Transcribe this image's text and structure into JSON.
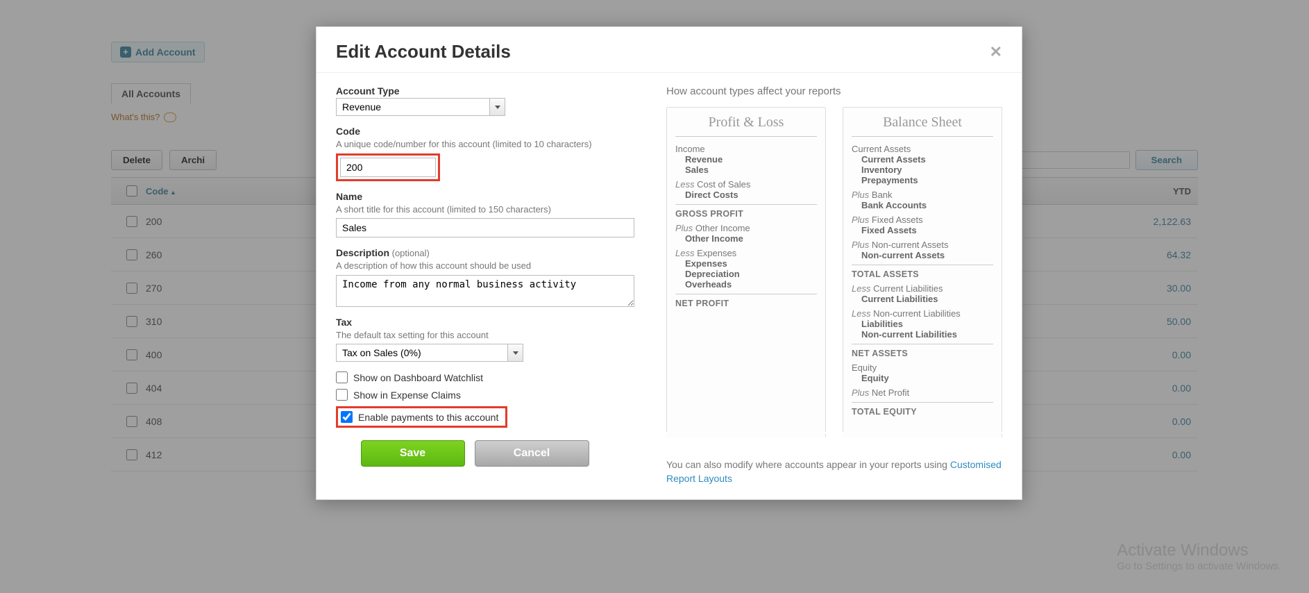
{
  "toolbar": {
    "add_account": "Add Account"
  },
  "tabs": {
    "all_accounts": "All Accounts"
  },
  "help_link": "What's this?",
  "actions": {
    "delete": "Delete",
    "archive": "Archi",
    "search": "Search"
  },
  "table": {
    "head_code": "Code",
    "head_ytd": "YTD",
    "rows": [
      {
        "code": "200",
        "ytd": "2,122.63"
      },
      {
        "code": "260",
        "ytd": "64.32"
      },
      {
        "code": "270",
        "ytd": "30.00"
      },
      {
        "code": "310",
        "ytd": "50.00"
      },
      {
        "code": "400",
        "ytd": "0.00"
      },
      {
        "code": "404",
        "ytd": "0.00"
      },
      {
        "code": "408",
        "ytd": "0.00"
      },
      {
        "code": "412",
        "ytd": "0.00"
      }
    ]
  },
  "modal": {
    "title": "Edit Account Details",
    "account_type_label": "Account Type",
    "account_type_value": "Revenue",
    "code_label": "Code",
    "code_help": "A unique code/number for this account (limited to 10 characters)",
    "code_value": "200",
    "name_label": "Name",
    "name_help": "A short title for this account (limited to 150 characters)",
    "name_value": "Sales",
    "desc_label": "Description",
    "desc_opt": " (optional)",
    "desc_help": "A description of how this account should be used",
    "desc_value": "Income from any normal business activity",
    "tax_label": "Tax",
    "tax_help": "The default tax setting for this account",
    "tax_value": "Tax on Sales (0%)",
    "chk_dashboard": "Show on Dashboard Watchlist",
    "chk_expense": "Show in Expense Claims",
    "chk_payments": "Enable payments to this account",
    "save": "Save",
    "cancel": "Cancel"
  },
  "info": {
    "head": "How account types affect your reports",
    "pl_title": "Profit & Loss",
    "bs_title": "Balance Sheet",
    "pl": {
      "income": "Income",
      "revenue": "Revenue",
      "sales": "Sales",
      "less_cos": "Less Cost of Sales",
      "direct_costs": "Direct Costs",
      "gross_profit": "GROSS PROFIT",
      "plus_other": "Plus Other Income",
      "other_income": "Other Income",
      "less_exp": "Less Expenses",
      "expenses": "Expenses",
      "depreciation": "Depreciation",
      "overheads": "Overheads",
      "net_profit": "NET PROFIT"
    },
    "bs": {
      "current_assets": "Current Assets",
      "ca_sub": "Current Assets",
      "inventory": "Inventory",
      "prepayments": "Prepayments",
      "plus_bank": "Plus Bank",
      "bank_accounts": "Bank Accounts",
      "plus_fixed": "Plus Fixed Assets",
      "fixed_assets": "Fixed Assets",
      "plus_nca": "Plus Non-current Assets",
      "nca": "Non-current Assets",
      "total_assets": "TOTAL ASSETS",
      "less_cl": "Less Current Liabilities",
      "cl": "Current Liabilities",
      "less_ncl": "Less Non-current Liabilities",
      "liabilities": "Liabilities",
      "ncl": "Non-current Liabilities",
      "net_assets": "NET ASSETS",
      "equity": "Equity",
      "equity_sub": "Equity",
      "plus_np": "Plus Net Profit",
      "total_equity": "TOTAL EQUITY"
    },
    "footer1": "You can also modify where accounts appear in your reports using ",
    "footer_link": "Customised Report Layouts"
  },
  "activate": {
    "l1": "Activate Windows",
    "l2": "Go to Settings to activate Windows."
  }
}
